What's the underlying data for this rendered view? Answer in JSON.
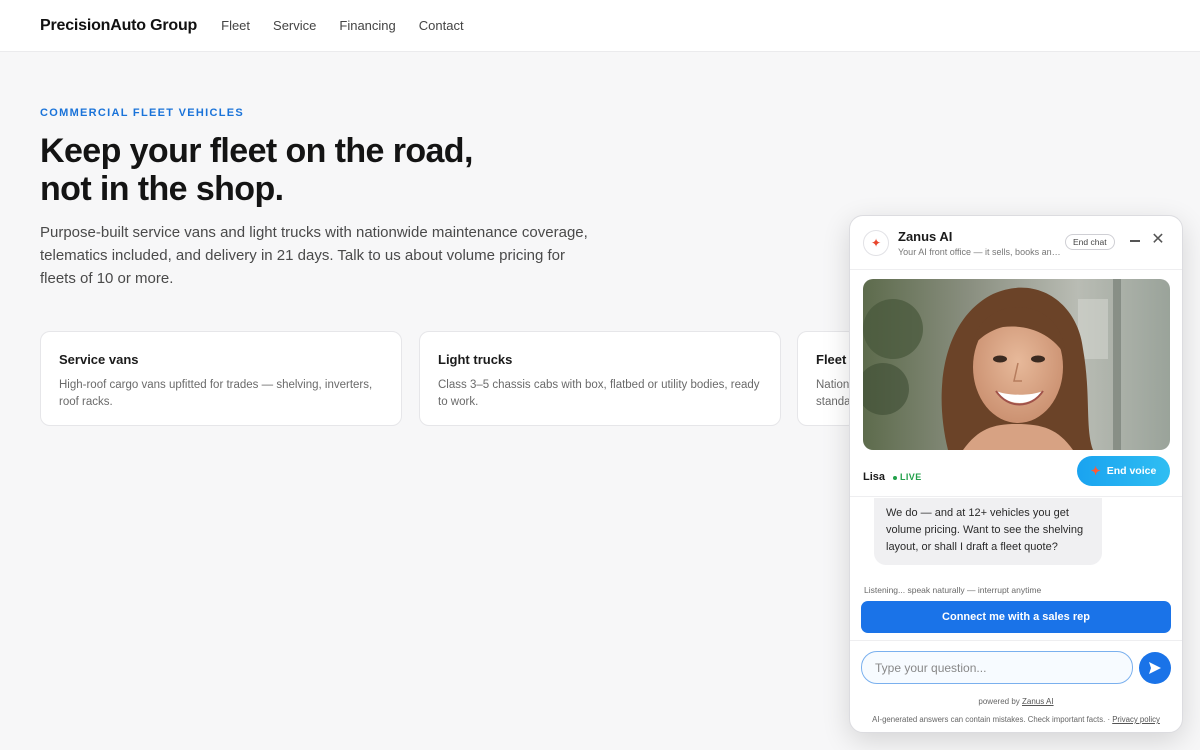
{
  "nav": {
    "brand_a": "Precision",
    "brand_b": "Auto",
    "brand_c": " Group",
    "links": [
      "Fleet",
      "Service",
      "Financing",
      "Contact"
    ]
  },
  "hero": {
    "eyebrow": "COMMERCIAL FLEET VEHICLES",
    "headline_1": "Keep your fleet on the road,",
    "headline_2": "not in the shop.",
    "lead": "Purpose-built service vans and light trucks with nationwide maintenance coverage, telematics included, and delivery in 21 days. Talk to us about volume pricing for fleets of 10 or more."
  },
  "cards": [
    {
      "title": "Service vans",
      "text": "High-roof cargo vans upfitted for trades — shelving, inverters, roof racks."
    },
    {
      "title": "Light trucks",
      "text": "Class 3–5 chassis cabs with box, flatbed or utility bodies, ready to work."
    },
    {
      "title": "Fleet",
      "text": "Nation standa"
    }
  ],
  "chat": {
    "name": "Zanus AI",
    "subtitle": "Your AI front office — it sells, books and ...",
    "end_chat": "End chat",
    "agent": "Lisa",
    "live": "LIVE",
    "end_voice": "End voice",
    "message": "We do — and at 12+ vehicles you get volume pricing. Want to see the shelving layout, or shall I draft a fleet quote?",
    "listening": "Listening... speak naturally — interrupt anytime",
    "cta": "Connect me with a sales rep",
    "input_placeholder": "Type your question...",
    "powered_prefix": "powered by ",
    "powered_link": "Zanus AI",
    "disclaimer_text": "AI-generated answers can contain mistakes. Check important facts. · ",
    "privacy_link": "Privacy policy"
  },
  "colors": {
    "accent": "#1a73e8",
    "eyebrow": "#1a73d9",
    "live": "#22a04a",
    "spark": "#e8452c"
  }
}
